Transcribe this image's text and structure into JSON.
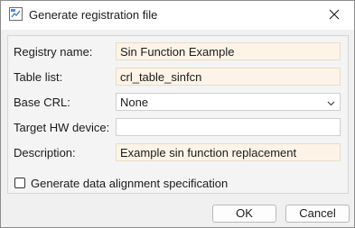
{
  "window": {
    "title": "Generate registration file",
    "app_icon": "matlab-figure-icon",
    "close_icon": "close-icon"
  },
  "form": {
    "registry_name": {
      "label": "Registry name:",
      "value": "Sin Function Example"
    },
    "table_list": {
      "label": "Table list:",
      "value": "crl_table_sinfcn"
    },
    "base_crl": {
      "label": "Base CRL:",
      "value": "None",
      "icon": "chevron-down-icon"
    },
    "target_hw_device": {
      "label": "Target HW device:",
      "value": ""
    },
    "description": {
      "label": "Description:",
      "value": "Example sin function replacement"
    },
    "data_alignment": {
      "label": "Generate data alignment specification",
      "checked": false
    }
  },
  "buttons": {
    "ok": "OK",
    "cancel": "Cancel"
  },
  "colors": {
    "tinted_field_bg": "#fdf4e7",
    "dialog_bg": "#f0f0f0"
  }
}
